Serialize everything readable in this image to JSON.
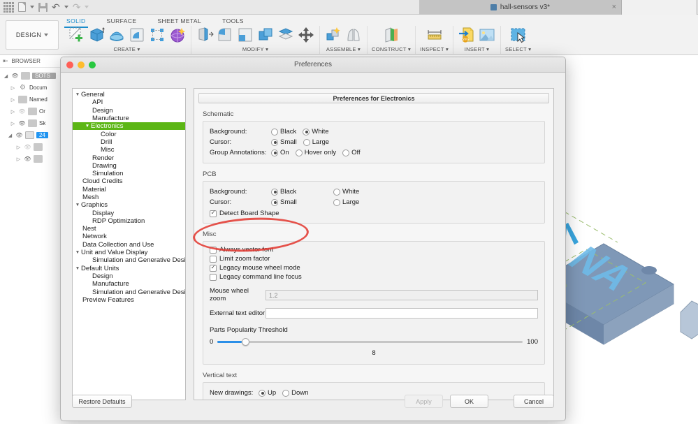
{
  "app": {
    "document_tab": "hall-sensors v3*",
    "workspace": "DESIGN",
    "quick_access": [
      "apps-grid-icon",
      "new-document-icon",
      "save-icon",
      "undo-icon",
      "redo-icon"
    ],
    "ribbon_tabs": [
      {
        "label": "SOLID",
        "active": true
      },
      {
        "label": "SURFACE",
        "active": false
      },
      {
        "label": "SHEET METAL",
        "active": false
      },
      {
        "label": "TOOLS",
        "active": false
      }
    ],
    "ribbon_groups": [
      {
        "label": "CREATE ▾",
        "icon_count": 5
      },
      {
        "label": "MODIFY ▾",
        "icon_count": 5
      },
      {
        "label": "ASSEMBLE ▾",
        "icon_count": 2
      },
      {
        "label": "CONSTRUCT ▾",
        "icon_count": 1
      },
      {
        "label": "INSPECT ▾",
        "icon_count": 1
      },
      {
        "label": "INSERT ▾",
        "icon_count": 2
      },
      {
        "label": "SELECT ▾",
        "icon_count": 1
      }
    ],
    "browser": {
      "title": "BROWSER",
      "items": [
        {
          "label": "SOTS",
          "visible": true,
          "selected_gray": true,
          "indent": 0,
          "icon": "component-icon"
        },
        {
          "label": "Docum",
          "visible": true,
          "indent": 1,
          "icon": "gear-icon"
        },
        {
          "label": "Named",
          "visible": true,
          "indent": 1,
          "icon": "folder-icon"
        },
        {
          "label": "Or",
          "visible": false,
          "indent": 2,
          "icon": "folder-icon"
        },
        {
          "label": "Sk",
          "visible": true,
          "indent": 2,
          "icon": "folder-icon"
        },
        {
          "label": "24",
          "visible": true,
          "selected": true,
          "indent": 1,
          "icon": "body-icon"
        },
        {
          "label": "",
          "visible": false,
          "indent": 2,
          "icon": "folder-icon"
        },
        {
          "label": "",
          "visible": true,
          "indent": 2,
          "icon": "folder-icon"
        }
      ]
    }
  },
  "dialog": {
    "title": "Preferences",
    "content_header": "Preferences for Electronics",
    "tree": [
      {
        "label": "General",
        "depth": 0,
        "disclosure": "▼"
      },
      {
        "label": "API",
        "depth": 1,
        "disclosure": ""
      },
      {
        "label": "Design",
        "depth": 1,
        "disclosure": ""
      },
      {
        "label": "Manufacture",
        "depth": 1,
        "disclosure": ""
      },
      {
        "label": "Electronics",
        "depth": 1,
        "disclosure": "▼",
        "selected": true
      },
      {
        "label": "Color",
        "depth": 2,
        "disclosure": ""
      },
      {
        "label": "Drill",
        "depth": 2,
        "disclosure": ""
      },
      {
        "label": "Misc",
        "depth": 2,
        "disclosure": ""
      },
      {
        "label": "Render",
        "depth": 1,
        "disclosure": ""
      },
      {
        "label": "Drawing",
        "depth": 1,
        "disclosure": ""
      },
      {
        "label": "Simulation",
        "depth": 1,
        "disclosure": ""
      },
      {
        "label": "Cloud Credits",
        "depth": 0,
        "disclosure": ""
      },
      {
        "label": "Material",
        "depth": 0,
        "disclosure": ""
      },
      {
        "label": "Mesh",
        "depth": 0,
        "disclosure": ""
      },
      {
        "label": "Graphics",
        "depth": 0,
        "disclosure": "▼"
      },
      {
        "label": "Display",
        "depth": 1,
        "disclosure": ""
      },
      {
        "label": "RDP Optimization",
        "depth": 1,
        "disclosure": ""
      },
      {
        "label": "Nest",
        "depth": 0,
        "disclosure": ""
      },
      {
        "label": "Network",
        "depth": 0,
        "disclosure": ""
      },
      {
        "label": "Data Collection and Use",
        "depth": 0,
        "disclosure": ""
      },
      {
        "label": "Unit and Value Display",
        "depth": 0,
        "disclosure": "▼"
      },
      {
        "label": "Simulation and Generative Desi...",
        "depth": 1,
        "disclosure": ""
      },
      {
        "label": "Default Units",
        "depth": 0,
        "disclosure": "▼"
      },
      {
        "label": "Design",
        "depth": 1,
        "disclosure": ""
      },
      {
        "label": "Manufacture",
        "depth": 1,
        "disclosure": ""
      },
      {
        "label": "Simulation and Generative Desi...",
        "depth": 1,
        "disclosure": ""
      },
      {
        "label": "Preview Features",
        "depth": 0,
        "disclosure": ""
      }
    ],
    "sections": {
      "schematic": {
        "title": "Schematic",
        "background": {
          "label": "Background:",
          "options": [
            {
              "label": "Black",
              "selected": false
            },
            {
              "label": "White",
              "selected": true
            }
          ]
        },
        "cursor": {
          "label": "Cursor:",
          "options": [
            {
              "label": "Small",
              "selected": true
            },
            {
              "label": "Large",
              "selected": false
            }
          ]
        },
        "group_annotations": {
          "label": "Group Annotations:",
          "options": [
            {
              "label": "On",
              "selected": true
            },
            {
              "label": "Hover only",
              "selected": false
            },
            {
              "label": "Off",
              "selected": false
            }
          ]
        }
      },
      "pcb": {
        "title": "PCB",
        "background": {
          "label": "Background:",
          "options": [
            {
              "label": "Black",
              "selected": true
            },
            {
              "label": "White",
              "selected": false
            }
          ]
        },
        "cursor": {
          "label": "Cursor:",
          "options": [
            {
              "label": "Small",
              "selected": true
            },
            {
              "label": "Large",
              "selected": false
            }
          ]
        },
        "detect_board_shape": {
          "label": "Detect Board Shape",
          "checked": true
        }
      },
      "misc": {
        "title": "Misc",
        "checkboxes": [
          {
            "label": "Always vector font",
            "checked": false
          },
          {
            "label": "Limit zoom factor",
            "checked": false
          },
          {
            "label": "Legacy mouse wheel mode",
            "checked": true
          },
          {
            "label": "Legacy command line focus",
            "checked": false
          }
        ],
        "mouse_wheel_zoom": {
          "label": "Mouse wheel zoom",
          "value": "1.2",
          "disabled": true
        },
        "external_text_editor": {
          "label": "External text editor",
          "value": ""
        },
        "parts_popularity": {
          "label": "Parts Popularity Threshold",
          "min": "0",
          "max": "100",
          "value": "8"
        }
      },
      "vertical_text": {
        "title": "Vertical text",
        "new_drawings": {
          "label": "New drawings:",
          "options": [
            {
              "label": "Up",
              "selected": true
            },
            {
              "label": "Down",
              "selected": false
            }
          ]
        }
      }
    },
    "footer": {
      "restore_defaults": "Restore Defaults",
      "apply": "Apply",
      "ok": "OK",
      "cancel": "Cancel"
    }
  },
  "colors": {
    "tree_selection_green": "#5cb615",
    "annotation_red": "#e23b33",
    "accent_blue": "#1a8ccc",
    "slider_blue": "#2b8fe8"
  }
}
